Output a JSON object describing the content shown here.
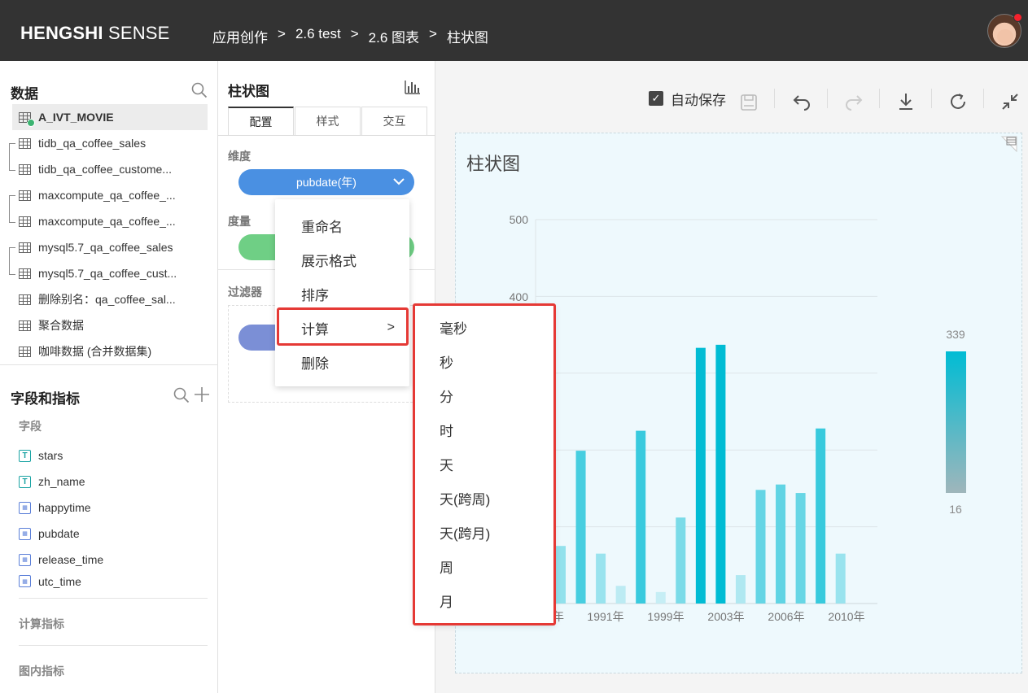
{
  "header": {
    "brand_bold": "HENGSHI",
    "brand_rest": " SENSE",
    "breadcrumb": [
      "应用创作",
      "2.6 test",
      "2.6 图表",
      "柱状图"
    ],
    "separator": ">"
  },
  "data_panel": {
    "title": "数据",
    "datasets": [
      "A_IVT_MOVIE",
      "tidb_qa_coffee_sales",
      "tidb_qa_coffee_custome...",
      "maxcompute_qa_coffee_...",
      "maxcompute_qa_coffee_...",
      "mysql5.7_qa_coffee_sales",
      "mysql5.7_qa_coffee_cust...",
      "删除别名：qa_coffee_sal...",
      "聚合数据",
      "咖啡数据 (合并数据集)"
    ]
  },
  "fields_panel": {
    "title": "字段和指标",
    "fields_label": "字段",
    "fields": [
      {
        "name": "stars",
        "type": "T"
      },
      {
        "name": "zh_name",
        "type": "T"
      },
      {
        "name": "happytime",
        "type": "D"
      },
      {
        "name": "pubdate",
        "type": "D"
      },
      {
        "name": "release_time",
        "type": "D"
      },
      {
        "name": "utc_time",
        "type": "D"
      }
    ],
    "calc_metrics_label": "计算指标",
    "chart_metrics_label": "图内指标"
  },
  "config_panel": {
    "title": "柱状图",
    "tabs": [
      "配置",
      "样式",
      "交互"
    ],
    "dimension_label": "维度",
    "dimension_value": "pubdate(年)",
    "measure_label": "度量",
    "filter_label": "过滤器"
  },
  "toolbar": {
    "autosave_label": "自动保存",
    "autosave_checked": true
  },
  "context_menu": {
    "items": [
      "重命名",
      "展示格式",
      "排序",
      "计算",
      "删除"
    ],
    "highlighted": "计算",
    "submenu_arrow": ">"
  },
  "submenu": {
    "items": [
      "毫秒",
      "秒",
      "分",
      "时",
      "天",
      "天(跨周)",
      "天(跨月)",
      "周",
      "月"
    ]
  },
  "chart_data": {
    "type": "bar",
    "title": "柱状图",
    "y_ticks": [
      "500",
      "400"
    ],
    "x_tick_labels": [
      "年",
      "1991年",
      "1999年",
      "2003年",
      "2006年",
      "2010年"
    ],
    "values": [
      75,
      199,
      65,
      23,
      225,
      15,
      112,
      333,
      337,
      37,
      148,
      155,
      144,
      228,
      65
    ],
    "ylim": [
      0,
      500
    ],
    "legend": {
      "max": "339",
      "min": "16"
    },
    "colors": {
      "high": "#00bcd4",
      "low": "#c6eef5"
    }
  }
}
